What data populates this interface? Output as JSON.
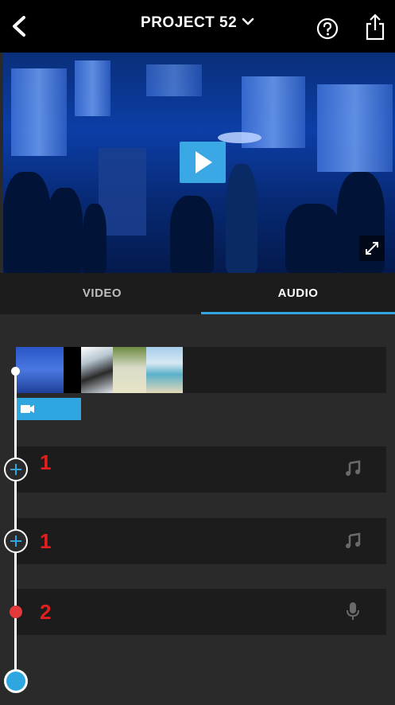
{
  "header": {
    "title": "PROJECT 52",
    "back_icon": "chevron-left-icon",
    "help_icon": "question-circle-icon",
    "share_icon": "share-icon",
    "title_dropdown_icon": "chevron-down-icon"
  },
  "preview": {
    "play_icon": "play-icon",
    "fullscreen_icon": "expand-icon"
  },
  "tabs": [
    {
      "label": "VIDEO",
      "active": false
    },
    {
      "label": "AUDIO",
      "active": true
    }
  ],
  "timeline": {
    "video_track": {
      "icon": "video-camera-icon"
    },
    "audio_tracks": [
      {
        "marker": "1",
        "type": "music",
        "icon": "music-note-icon"
      },
      {
        "marker": "1",
        "type": "music",
        "icon": "music-note-icon"
      },
      {
        "marker": "2",
        "type": "voiceover",
        "icon": "microphone-icon"
      }
    ]
  },
  "colors": {
    "accent": "#2fa6e0",
    "record": "#e23a3a",
    "annotation": "#e02020"
  }
}
